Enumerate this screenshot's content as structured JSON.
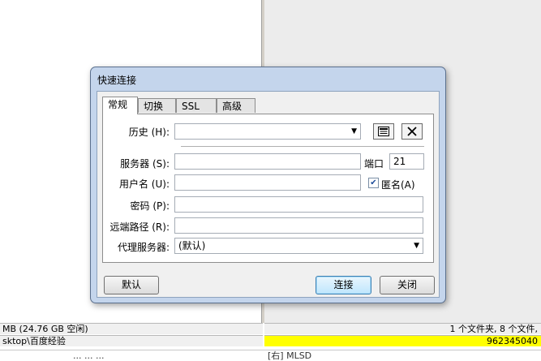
{
  "background": {
    "status_left_top": "MB (24.76 GB 空闲)",
    "status_left_bottom": "sktop\\百度经验",
    "status_right_top": "1 个文件夹, 8 个文件,",
    "status_right_bottom": "962345040",
    "tail_left": "...  ...  ...",
    "tail_right": "[右] MLSD"
  },
  "dialog": {
    "title": "快速连接",
    "tabs": [
      {
        "label": "常规"
      },
      {
        "label": "切换"
      },
      {
        "label": "SSL"
      },
      {
        "label": "高级"
      }
    ],
    "fields": {
      "history_label": "历史 (H):",
      "history_value": "",
      "server_label": "服务器 (S):",
      "server_value": "",
      "port_label": "端口",
      "port_value": "21",
      "username_label": "用户名 (U):",
      "username_value": "",
      "anonymous_label": "匿名(A)",
      "anonymous_checked": true,
      "password_label": "密码 (P):",
      "password_value": "",
      "remote_path_label": "远端路径 (R):",
      "remote_path_value": "",
      "proxy_label": "代理服务器:",
      "proxy_value": "(默认)"
    },
    "buttons": {
      "default_label": "默认",
      "connect_label": "连接",
      "close_label": "关闭"
    },
    "icons": {
      "history_browse": "address-book-icon",
      "history_delete": "close-icon"
    },
    "colors": {
      "highlight": "#ffff00",
      "dialog_frame": "#c4d5ec"
    }
  }
}
